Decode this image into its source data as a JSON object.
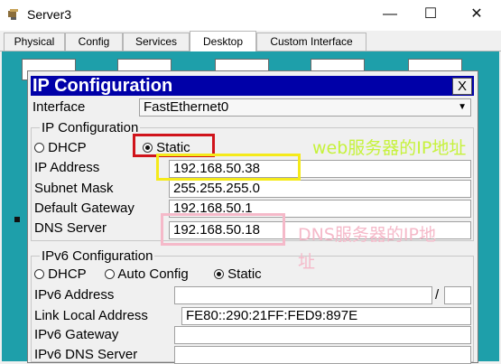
{
  "window": {
    "title": "Server3",
    "minimize": "—",
    "maximize": "☐",
    "close": "✕"
  },
  "tabs": [
    "Physical",
    "Config",
    "Services",
    "Desktop",
    "Custom Interface"
  ],
  "dialog": {
    "title": "IP Configuration",
    "close": "X",
    "interface_label": "Interface",
    "interface_value": "FastEthernet0",
    "ipv4": {
      "group_label": "IP Configuration",
      "dhcp": "DHCP",
      "static": "Static",
      "ip_label": "IP Address",
      "ip_value": "192.168.50.38",
      "mask_label": "Subnet Mask",
      "mask_value": "255.255.255.0",
      "gateway_label": "Default Gateway",
      "gateway_value": "192.168.50.1",
      "dns_label": "DNS Server",
      "dns_value": "192.168.50.18"
    },
    "ipv6": {
      "group_label": "IPv6 Configuration",
      "dhcp": "DHCP",
      "auto": "Auto Config",
      "static": "Static",
      "address_label": "IPv6 Address",
      "address_value": "",
      "slash": "/",
      "link_local_label": "Link Local Address",
      "link_local_value": "FE80::290:21FF:FED9:897E",
      "gateway_label": "IPv6 Gateway",
      "gateway_value": "",
      "dns_label": "IPv6 DNS Server",
      "dns_value": ""
    }
  },
  "annotations": {
    "web": "web服务器的IP地址",
    "dns_line1": "DNS服务器的IP地",
    "dns_line2": "址"
  },
  "colors": {
    "annotation_web": "#c6f23b",
    "annotation_dns": "#f5b9c9",
    "highlight_red": "#d0131b",
    "highlight_yellow": "#f5ea1a",
    "highlight_pink": "#f5b9c9",
    "dialog_title_bg": "#0000a8",
    "desktop_bg": "#1e9faa"
  }
}
